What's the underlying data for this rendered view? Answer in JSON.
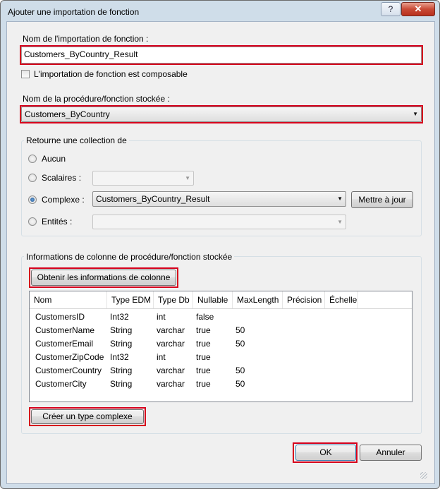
{
  "window": {
    "title": "Ajouter une importation de fonction",
    "help_glyph": "?",
    "close_glyph": "✕"
  },
  "function_import": {
    "name_label": "Nom de l'importation de fonction :",
    "name_value": "Customers_ByCountry_Result",
    "composable_label": "L'importation de fonction est composable",
    "composable_checked": false
  },
  "stored_procedure": {
    "label": "Nom de la procédure/fonction stockée :",
    "value": "Customers_ByCountry"
  },
  "returns": {
    "group_title": "Retourne une collection de",
    "options": {
      "none": {
        "label": "Aucun",
        "selected": false
      },
      "scalars": {
        "label": "Scalaires :",
        "selected": false,
        "value": ""
      },
      "complex": {
        "label": "Complexe :",
        "selected": true,
        "value": "Customers_ByCountry_Result"
      },
      "entities": {
        "label": "Entités :",
        "selected": false,
        "value": ""
      }
    },
    "update_button": "Mettre à jour"
  },
  "columns": {
    "group_title": "Informations de colonne de procédure/fonction stockée",
    "get_info_button": "Obtenir les informations de colonne",
    "headers": [
      "Nom",
      "Type EDM",
      "Type Db",
      "Nullable",
      "MaxLength",
      "Précision",
      "Échelle"
    ],
    "rows": [
      [
        "CustomersID",
        "Int32",
        "int",
        "false",
        "",
        "",
        ""
      ],
      [
        "CustomerName",
        "String",
        "varchar",
        "true",
        "50",
        "",
        ""
      ],
      [
        "CustomerEmail",
        "String",
        "varchar",
        "true",
        "50",
        "",
        ""
      ],
      [
        "CustomerZipCode",
        "Int32",
        "int",
        "true",
        "",
        "",
        ""
      ],
      [
        "CustomerCountry",
        "String",
        "varchar",
        "true",
        "50",
        "",
        ""
      ],
      [
        "CustomerCity",
        "String",
        "varchar",
        "true",
        "50",
        "",
        ""
      ]
    ],
    "create_complex_button": "Créer un type complexe"
  },
  "footer": {
    "ok_label": "OK",
    "cancel_label": "Annuler"
  },
  "colors": {
    "highlight_red": "#d6001c",
    "window_frame": "#cfdde9",
    "client_bg": "#f0f0f0"
  }
}
